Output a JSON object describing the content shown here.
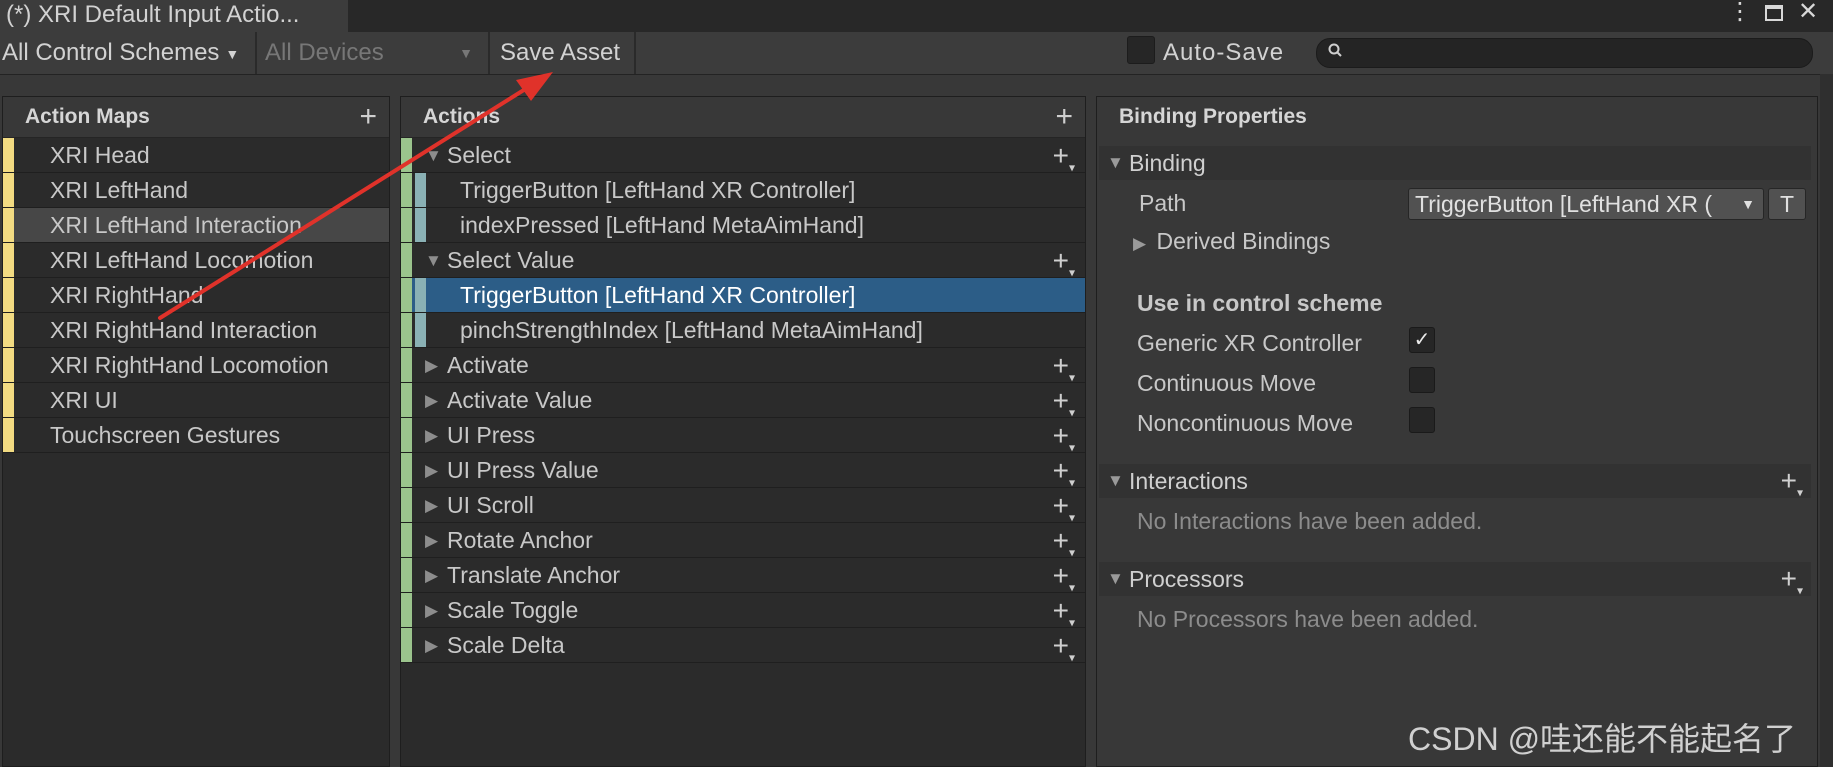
{
  "window": {
    "tab_title": "(*) XRI Default Input Actio..."
  },
  "toolbar": {
    "control_schemes": "All Control Schemes",
    "devices": "All Devices",
    "save_asset": "Save Asset",
    "auto_save": "Auto-Save",
    "auto_save_checked": false,
    "search_placeholder": ""
  },
  "action_maps": {
    "title": "Action Maps",
    "items": [
      {
        "label": "XRI Head"
      },
      {
        "label": "XRI LeftHand"
      },
      {
        "label": "XRI LeftHand Interaction",
        "active": true
      },
      {
        "label": "XRI LeftHand Locomotion"
      },
      {
        "label": "XRI RightHand"
      },
      {
        "label": "XRI RightHand Interaction"
      },
      {
        "label": "XRI RightHand Locomotion"
      },
      {
        "label": "XRI UI"
      },
      {
        "label": "Touchscreen Gestures"
      }
    ]
  },
  "actions": {
    "title": "Actions",
    "rows": [
      {
        "type": "action",
        "label": "Select",
        "expanded": true
      },
      {
        "type": "binding",
        "label": "TriggerButton [LeftHand XR Controller]"
      },
      {
        "type": "binding",
        "label": "indexPressed [LeftHand MetaAimHand]"
      },
      {
        "type": "action",
        "label": "Select Value",
        "expanded": true
      },
      {
        "type": "binding",
        "label": "TriggerButton [LeftHand XR Controller]",
        "selected": true
      },
      {
        "type": "binding",
        "label": "pinchStrengthIndex [LeftHand MetaAimHand]"
      },
      {
        "type": "action",
        "label": "Activate",
        "expanded": false
      },
      {
        "type": "action",
        "label": "Activate Value",
        "expanded": false
      },
      {
        "type": "action",
        "label": "UI Press",
        "expanded": false
      },
      {
        "type": "action",
        "label": "UI Press Value",
        "expanded": false
      },
      {
        "type": "action",
        "label": "UI Scroll",
        "expanded": false
      },
      {
        "type": "action",
        "label": "Rotate Anchor",
        "expanded": false
      },
      {
        "type": "action",
        "label": "Translate Anchor",
        "expanded": false
      },
      {
        "type": "action",
        "label": "Scale Toggle",
        "expanded": false
      },
      {
        "type": "action",
        "label": "Scale Delta",
        "expanded": false
      }
    ]
  },
  "properties": {
    "title": "Binding Properties",
    "binding_section": "Binding",
    "path_label": "Path",
    "path_value": "TriggerButton [LeftHand XR (",
    "t_button": "T",
    "derived_bindings": "Derived Bindings",
    "control_scheme_heading": "Use in control scheme",
    "schemes": [
      {
        "label": "Generic XR Controller",
        "checked": true
      },
      {
        "label": "Continuous Move",
        "checked": false
      },
      {
        "label": "Noncontinuous Move",
        "checked": false
      }
    ],
    "interactions_section": "Interactions",
    "interactions_empty": "No Interactions have been added.",
    "processors_section": "Processors",
    "processors_empty": "No Processors have been added."
  },
  "watermark": "CSDN @哇还能不能起名了",
  "colors": {
    "map_stripe": "#f2db82",
    "action_stripe": "#9bc48d",
    "binding_stripe": "#8ab1b5",
    "selection": "#2c5d87",
    "annotation_arrow": "#e0322a"
  }
}
